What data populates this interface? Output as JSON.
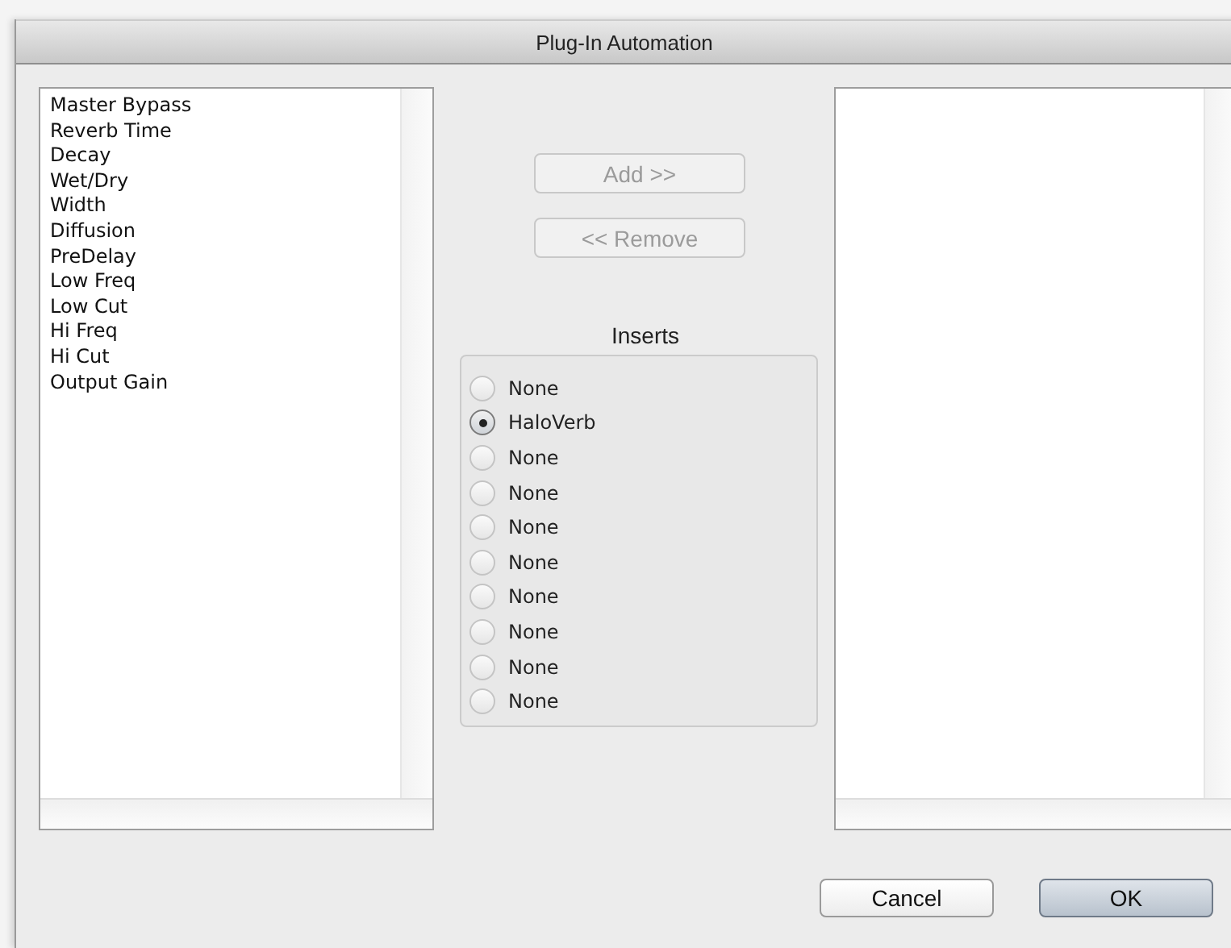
{
  "window": {
    "title": "Plug-In Automation"
  },
  "parameters": [
    "Master Bypass",
    "Reverb Time",
    "Decay",
    "Wet/Dry",
    "Width",
    "Diffusion",
    "PreDelay",
    "Low Freq",
    "Low Cut",
    "Hi Freq",
    "Hi Cut",
    "Output Gain"
  ],
  "add_button": {
    "label": "Add >>",
    "disabled": true
  },
  "remove_button": {
    "label": "<< Remove",
    "disabled": true
  },
  "inserts": {
    "title": "Inserts",
    "options": [
      {
        "label": "None",
        "selected": false
      },
      {
        "label": "HaloVerb",
        "selected": true
      },
      {
        "label": "None",
        "selected": false
      },
      {
        "label": "None",
        "selected": false
      },
      {
        "label": "None",
        "selected": false
      },
      {
        "label": "None",
        "selected": false
      },
      {
        "label": "None",
        "selected": false
      },
      {
        "label": "None",
        "selected": false
      },
      {
        "label": "None",
        "selected": false
      },
      {
        "label": "None",
        "selected": false
      }
    ]
  },
  "buttons": [
    {
      "label": "Cancel",
      "default": false
    },
    {
      "label": "OK",
      "default": true
    }
  ]
}
